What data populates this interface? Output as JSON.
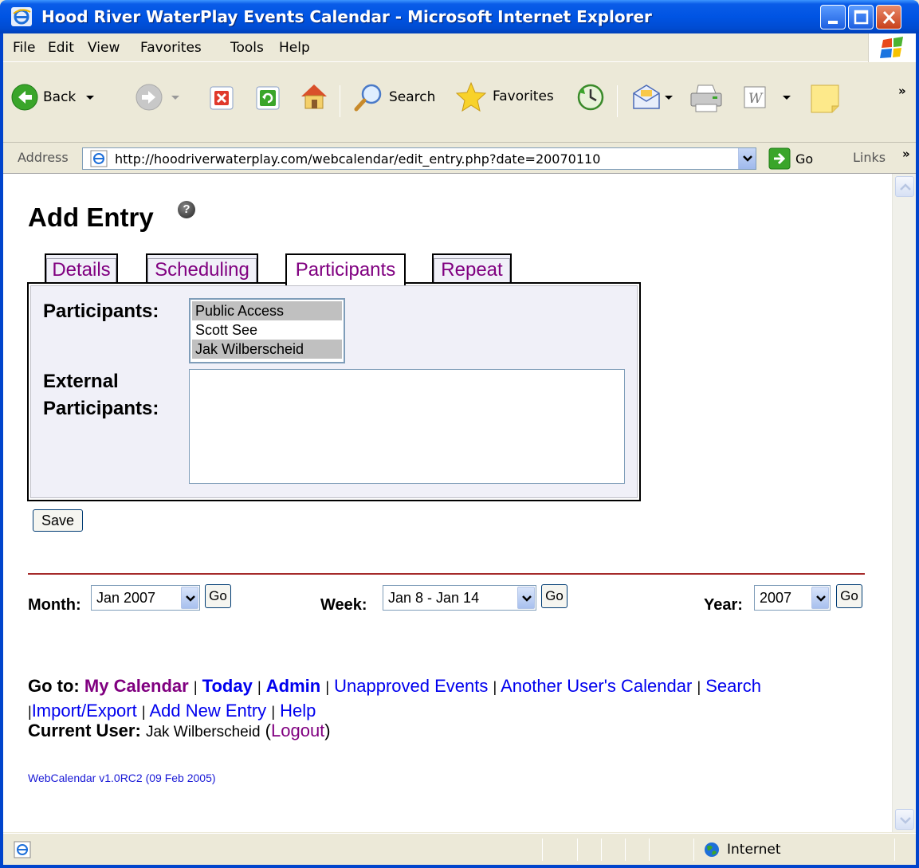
{
  "window": {
    "title": "Hood River WaterPlay Events Calendar - Microsoft Internet Explorer"
  },
  "menu": {
    "items": [
      "File",
      "Edit",
      "View",
      "Favorites",
      "Tools",
      "Help"
    ]
  },
  "toolbar": {
    "back_label": "Back",
    "search_label": "Search",
    "favorites_label": "Favorites"
  },
  "address": {
    "label": "Address",
    "url": "http://hoodriverwaterplay.com/webcalendar/edit_entry.php?date=20070110",
    "go_label": "Go",
    "links_label": "Links"
  },
  "page": {
    "title": "Add Entry",
    "help_glyph": "?",
    "tabs": [
      {
        "label": "Details"
      },
      {
        "label": "Scheduling"
      },
      {
        "label": "Participants"
      },
      {
        "label": "Repeat"
      }
    ],
    "participants_label": "Participants:",
    "participants": [
      {
        "name": "Public Access",
        "selected": true
      },
      {
        "name": "Scott See",
        "selected": false
      },
      {
        "name": "Jak Wilberscheid",
        "selected": true
      }
    ],
    "external_label_line1": "External",
    "external_label_line2": "Participants:",
    "external_value": "",
    "save_label": "Save",
    "month_label": "Month:",
    "month_value": "Jan 2007",
    "week_label": "Week:",
    "week_value": "Jan 8 - Jan 14",
    "year_label": "Year:",
    "year_value": "2007",
    "go_label": "Go",
    "goto_label": "Go to:",
    "links": {
      "my_calendar": "My Calendar",
      "today": "Today",
      "admin": "Admin",
      "unapproved": "Unapproved Events",
      "another_user": "Another User's Calendar",
      "search": "Search",
      "import_export": "Import/Export",
      "add_new": "Add New Entry",
      "help": "Help"
    },
    "current_user_label": "Current User:",
    "current_user": "Jak Wilberscheid",
    "logout_label": "Logout",
    "version": "WebCalendar v1.0RC2 (09 Feb 2005)"
  },
  "status": {
    "zone": "Internet"
  },
  "colors": {
    "link_purple": "#800080",
    "link_blue": "#0000ee",
    "tab_text": "#800080",
    "divider": "#a52a2a"
  }
}
